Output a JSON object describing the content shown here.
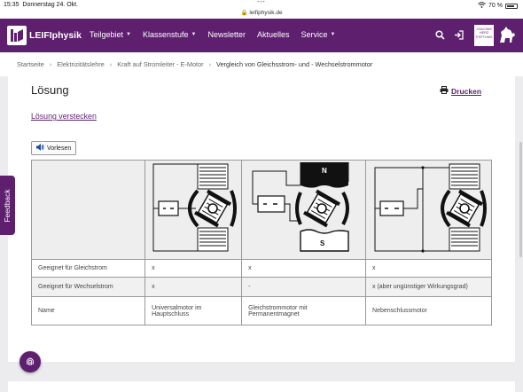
{
  "status_bar": {
    "time": "15:35",
    "date": "Donnerstag 24. Okt.",
    "url": "leifiphysik.de",
    "battery": "70 %"
  },
  "header": {
    "logo_text": "LEIFIphysik",
    "nav": [
      {
        "label": "Teilgebiet",
        "has_dropdown": true
      },
      {
        "label": "Klassenstufe",
        "has_dropdown": true
      },
      {
        "label": "Newsletter",
        "has_dropdown": false
      },
      {
        "label": "Aktuelles",
        "has_dropdown": false
      },
      {
        "label": "Service",
        "has_dropdown": true
      }
    ],
    "stiftung_text": "JOACHIM HERZ STIFTUNG",
    "brand_color": "#5e1f6e"
  },
  "breadcrumb": [
    "Startseite",
    "Elektrizitätslehre",
    "Kraft auf Stromleiter - E-Motor",
    "Vergleich von Gleichsstrom- und - Wechselstrommotor"
  ],
  "content": {
    "title": "Lösung",
    "print_label": "Drucken",
    "hide_link": "Lösung verstecken",
    "read_aloud": "Vorlesen",
    "table": {
      "rows": [
        {
          "label": "Geeignet für Gleichstrom",
          "cells": [
            "x",
            "x",
            "x"
          ]
        },
        {
          "label": "Geeignet für Wechselstrom",
          "cells": [
            "x",
            "-",
            "x (aber ungünstiger Wirkungsgrad)"
          ]
        },
        {
          "label": "Name",
          "cells": [
            "Universalmotor im Hauptschluss",
            "Gleichstrommotor mit Permanentmagnet",
            "Nebenschlussmotor"
          ]
        }
      ],
      "magnet_labels": {
        "north": "N",
        "south": "S"
      }
    }
  },
  "feedback_label": "Feedback"
}
